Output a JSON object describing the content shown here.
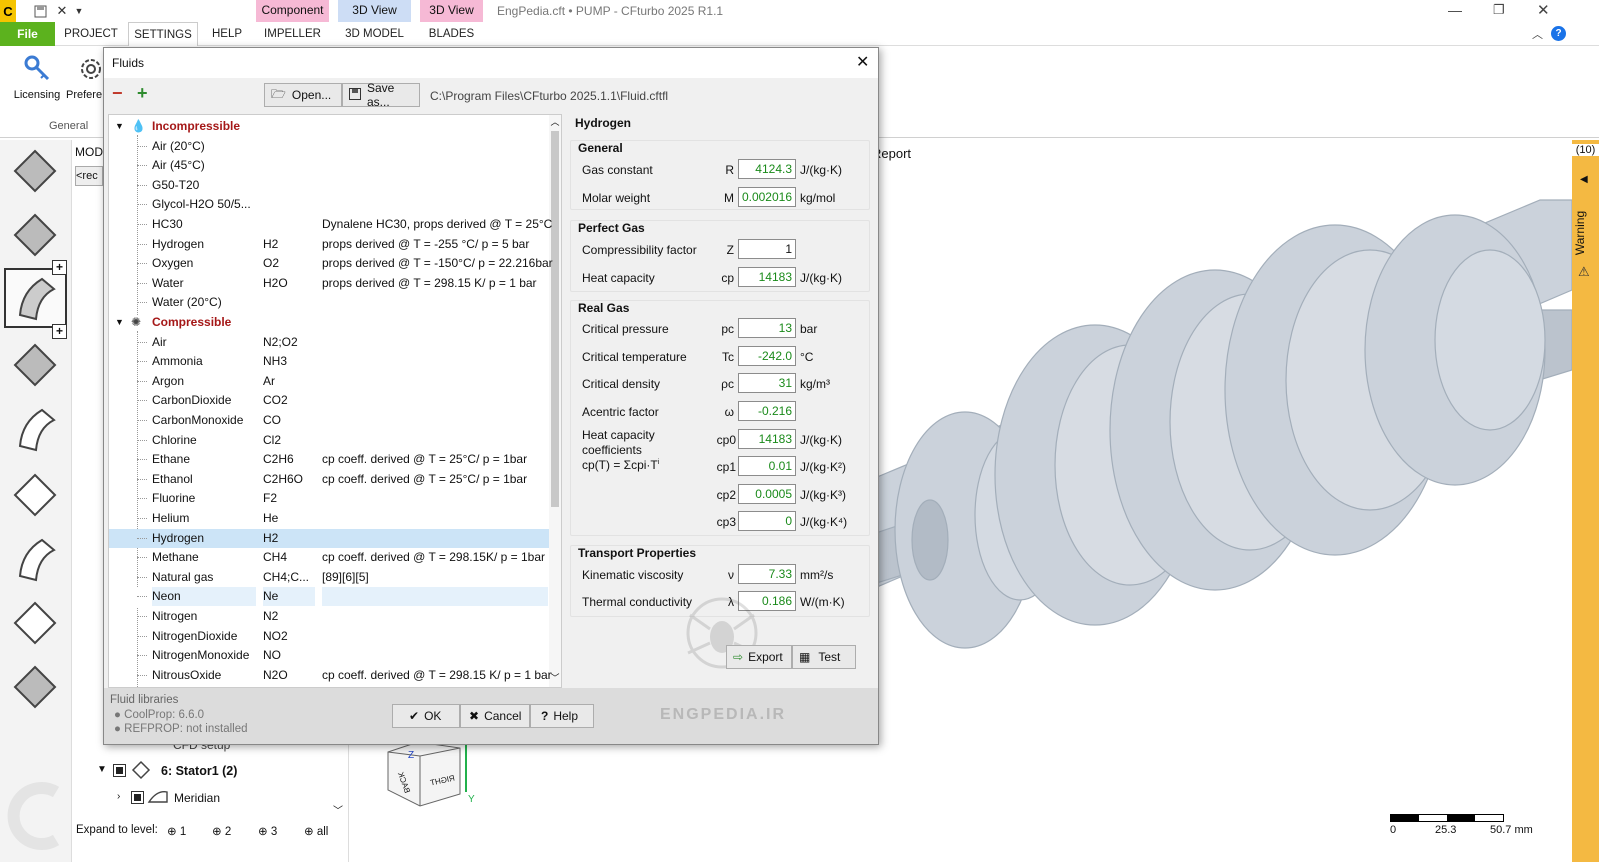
{
  "app": {
    "title": "EngPedia.cft • PUMP - CFturbo 2025 R1.1"
  },
  "context_tabs": [
    {
      "label": "Component",
      "color": "#f6b9d5"
    },
    {
      "label": "3D View",
      "color": "#cdddf5"
    },
    {
      "label": "3D View",
      "color": "#f6b9d5"
    }
  ],
  "menu": {
    "file": "File",
    "items": [
      "PROJECT",
      "SETTINGS",
      "HELP",
      "IMPELLER",
      "3D MODEL",
      "BLADES"
    ]
  },
  "ribbon": {
    "licensing": "Licensing",
    "preferences": "Prefere",
    "group": "General"
  },
  "left_panel": {
    "mod_label": "MOD",
    "rec_label": "<rec",
    "stator": "6: Stator1 (2)",
    "meridian": "Meridian",
    "cfd": "CFD setup",
    "expand_label": "Expand to level:",
    "levels": [
      "1",
      "2",
      "3",
      "all"
    ]
  },
  "viewport": {
    "report": "Report",
    "scale": [
      "0",
      "25.3",
      "50.7 mm"
    ],
    "cube": [
      "RIGHT",
      "BACK"
    ],
    "axis_y": "Y",
    "axis_z": "Z"
  },
  "warnings": {
    "count": "(10)",
    "label": "Warning"
  },
  "dialog": {
    "title": "Fluids",
    "open_label": "Open...",
    "saveas_label": "Save as...",
    "path": "C:\\Program Files\\CFturbo 2025.1.1\\Fluid.cftfl",
    "tree": {
      "incompressible": "Incompressible",
      "incomp_items": [
        {
          "name": "Air (20°C)",
          "formula": "",
          "desc": ""
        },
        {
          "name": "Air (45°C)",
          "formula": "",
          "desc": ""
        },
        {
          "name": "G50-T20",
          "formula": "",
          "desc": ""
        },
        {
          "name": "Glycol-H2O 50/5...",
          "formula": "",
          "desc": ""
        },
        {
          "name": "HC30",
          "formula": "",
          "desc": "Dynalene HC30, props derived @ T = 25°C"
        },
        {
          "name": "Hydrogen",
          "formula": "H2",
          "desc": "props derived @ T = -255 °C/ p = 5 bar"
        },
        {
          "name": "Oxygen",
          "formula": "O2",
          "desc": "props derived @ T = -150°C/ p = 22.216bar"
        },
        {
          "name": "Water",
          "formula": "H2O",
          "desc": "props derived @ T = 298.15 K/ p = 1 bar"
        },
        {
          "name": "Water (20°C)",
          "formula": "",
          "desc": ""
        }
      ],
      "compressible": "Compressible",
      "comp_items": [
        {
          "name": "Air",
          "formula": "N2;O2",
          "desc": ""
        },
        {
          "name": "Ammonia",
          "formula": "NH3",
          "desc": ""
        },
        {
          "name": "Argon",
          "formula": "Ar",
          "desc": ""
        },
        {
          "name": "CarbonDioxide",
          "formula": "CO2",
          "desc": ""
        },
        {
          "name": "CarbonMonoxide",
          "formula": "CO",
          "desc": ""
        },
        {
          "name": "Chlorine",
          "formula": "Cl2",
          "desc": ""
        },
        {
          "name": "Ethane",
          "formula": "C2H6",
          "desc": "cp coeff. derived @ T = 25°C/ p = 1bar"
        },
        {
          "name": "Ethanol",
          "formula": "C2H6O",
          "desc": "cp coeff. derived @ T = 25°C/ p = 1bar"
        },
        {
          "name": "Fluorine",
          "formula": "F2",
          "desc": ""
        },
        {
          "name": "Helium",
          "formula": "He",
          "desc": ""
        },
        {
          "name": "Hydrogen",
          "formula": "H2",
          "desc": ""
        },
        {
          "name": "Methane",
          "formula": "CH4",
          "desc": "cp coeff. derived @ T = 298.15K/ p = 1bar"
        },
        {
          "name": "Natural gas",
          "formula": "CH4;C...",
          "desc": "[89][6][5]"
        },
        {
          "name": "Neon",
          "formula": "Ne",
          "desc": ""
        },
        {
          "name": "Nitrogen",
          "formula": "N2",
          "desc": ""
        },
        {
          "name": "NitrogenDioxide",
          "formula": "NO2",
          "desc": ""
        },
        {
          "name": "NitrogenMonoxide",
          "formula": "NO",
          "desc": ""
        },
        {
          "name": "NitrousOxide",
          "formula": "N2O",
          "desc": "cp coeff. derived @ T = 298.15 K/ p = 1 bar"
        }
      ]
    },
    "props": {
      "fluid_name": "Hydrogen",
      "general": {
        "title": "General",
        "gas_constant": {
          "label": "Gas constant",
          "sym": "R",
          "value": "4124.3",
          "unit": "J/(kg·K)"
        },
        "molar_weight": {
          "label": "Molar weight",
          "sym": "M",
          "value": "0.002016",
          "unit": "kg/mol"
        }
      },
      "perfect_gas": {
        "title": "Perfect Gas",
        "compressibility": {
          "label": "Compressibility factor",
          "sym": "Z",
          "value": "1",
          "unit": ""
        },
        "heat_capacity": {
          "label": "Heat capacity",
          "sym": "cp",
          "value": "14183",
          "unit": "J/(kg·K)"
        }
      },
      "real_gas": {
        "title": "Real Gas",
        "crit_pressure": {
          "label": "Critical pressure",
          "sym": "pc",
          "value": "13",
          "unit": "bar"
        },
        "crit_temp": {
          "label": "Critical temperature",
          "sym": "Tc",
          "value": "-242.0",
          "unit": "°C"
        },
        "crit_density": {
          "label": "Critical density",
          "sym": "ρc",
          "value": "31",
          "unit": "kg/m³"
        },
        "acentric": {
          "label": "Acentric factor",
          "sym": "ω",
          "value": "-0.216",
          "unit": ""
        },
        "hc_label1": "Heat capacity",
        "hc_label2": "coefficients",
        "hc_label3": "cp(T) = Σcpi·T",
        "cp0": {
          "sym": "cp0",
          "value": "14183",
          "unit": "J/(kg·K)"
        },
        "cp1": {
          "sym": "cp1",
          "value": "0.01",
          "unit": "J/(kg·K²)"
        },
        "cp2": {
          "sym": "cp2",
          "value": "0.0005",
          "unit": "J/(kg·K³)"
        },
        "cp3": {
          "sym": "cp3",
          "value": "0",
          "unit": "J/(kg·K⁴)"
        }
      },
      "transport": {
        "title": "Transport Properties",
        "kin_visc": {
          "label": "Kinematic viscosity",
          "sym": "ν",
          "value": "7.33",
          "unit": "mm²/s"
        },
        "therm_cond": {
          "label": "Thermal conductivity",
          "sym": "λ",
          "value": "0.186",
          "unit": "W/(m·K)"
        }
      }
    },
    "export_label": "Export",
    "test_label": "Test",
    "libraries": {
      "title": "Fluid libraries",
      "coolprop": "● CoolProp: 6.6.0",
      "refprop": "● REFPROP: not installed"
    },
    "ok_label": "OK",
    "cancel_label": "Cancel",
    "help_label": "Help",
    "watermark": "ENGPEDIA.IR"
  }
}
